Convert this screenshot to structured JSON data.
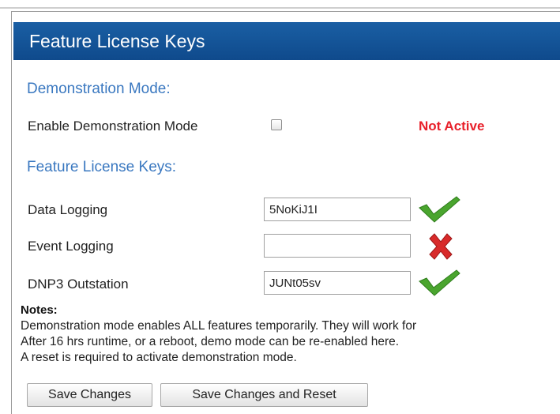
{
  "header": {
    "title": "Feature License Keys"
  },
  "demo": {
    "section_title": "Demonstration Mode:",
    "enable_label": "Enable Demonstration Mode",
    "enabled": false,
    "status": "Not Active",
    "status_color": "#e8202a"
  },
  "license": {
    "section_title": "Feature License Keys:",
    "keys": [
      {
        "label": "Data Logging",
        "value": "5NoKiJ1I",
        "status_icon": "check-icon",
        "valid": true
      },
      {
        "label": "Event Logging",
        "value": "",
        "status_icon": "cross-icon",
        "valid": false
      },
      {
        "label": "DNP3 Outstation",
        "value": "JUNt05sv",
        "status_icon": "check-icon",
        "valid": true
      }
    ]
  },
  "notes": {
    "title": "Notes:",
    "lines": [
      "Demonstration mode enables ALL features temporarily. They will work for",
      "After 16 hrs runtime, or a reboot, demo mode can be re-enabled here.",
      "A reset is required to activate demonstration mode."
    ]
  },
  "buttons": {
    "save": "Save Changes",
    "save_reset": "Save Changes and Reset"
  },
  "colors": {
    "header_bg": "#0f4a8c",
    "section_title": "#3a78c0",
    "valid_check": "#4aa52e",
    "invalid_cross": "#d82a2a"
  }
}
